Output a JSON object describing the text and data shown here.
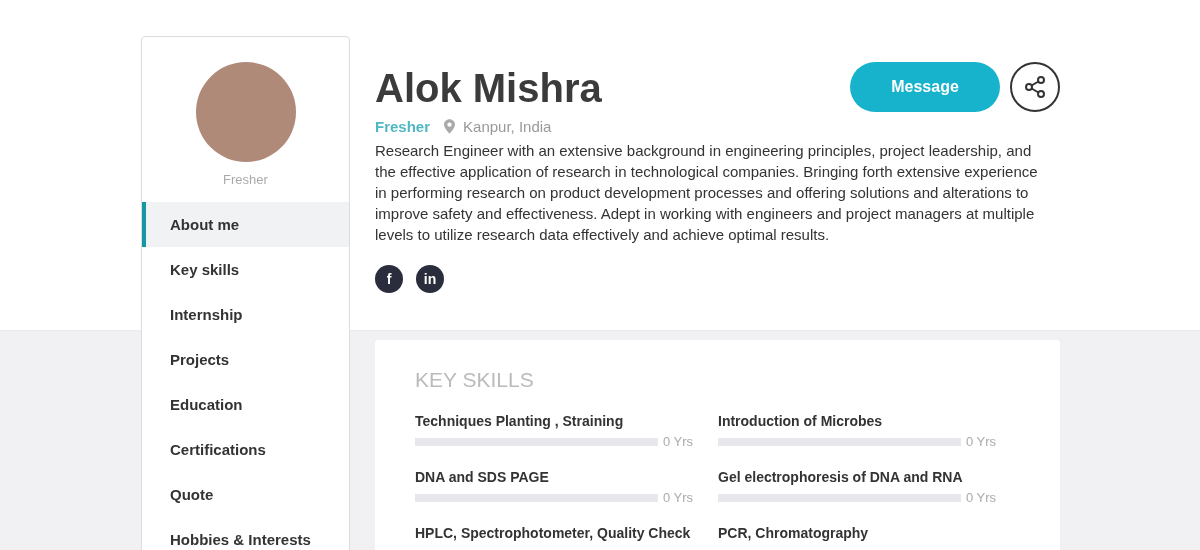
{
  "sidebar": {
    "caption": "Fresher",
    "nav": [
      {
        "label": "About me",
        "selected": true
      },
      {
        "label": "Key skills",
        "selected": false
      },
      {
        "label": "Internship",
        "selected": false
      },
      {
        "label": "Projects",
        "selected": false
      },
      {
        "label": "Education",
        "selected": false
      },
      {
        "label": "Certifications",
        "selected": false
      },
      {
        "label": "Quote",
        "selected": false
      },
      {
        "label": "Hobbies & Interests",
        "selected": false
      }
    ]
  },
  "profile": {
    "name": "Alok Mishra",
    "status": "Fresher",
    "location": "Kanpur, India",
    "message_button": "Message",
    "bio": "Research Engineer with an extensive background in engineering principles, project leadership, and the effective application of research in technological companies. Bringing forth extensive experience in performing research on product development processes and offering solutions and alterations to improve safety and effectiveness. Adept in working with engineers and project managers at multiple levels to utilize research data effectively and achieve optimal results.",
    "social": [
      {
        "glyph": "f"
      },
      {
        "glyph": "in"
      }
    ]
  },
  "key_skills": {
    "title": "KEY SKILLS",
    "skills": [
      {
        "name": "Techniques Planting , Straining",
        "reading": "0 Yrs"
      },
      {
        "name": "Introduction of Microbes",
        "reading": "0 Yrs"
      },
      {
        "name": "DNA and SDS PAGE",
        "reading": "0 Yrs"
      },
      {
        "name": "Gel electrophoresis of DNA and RNA",
        "reading": "0 Yrs"
      },
      {
        "name": "HPLC, Spectrophotometer, Quality Check"
      },
      {
        "name": "PCR, Chromatography"
      }
    ]
  }
}
